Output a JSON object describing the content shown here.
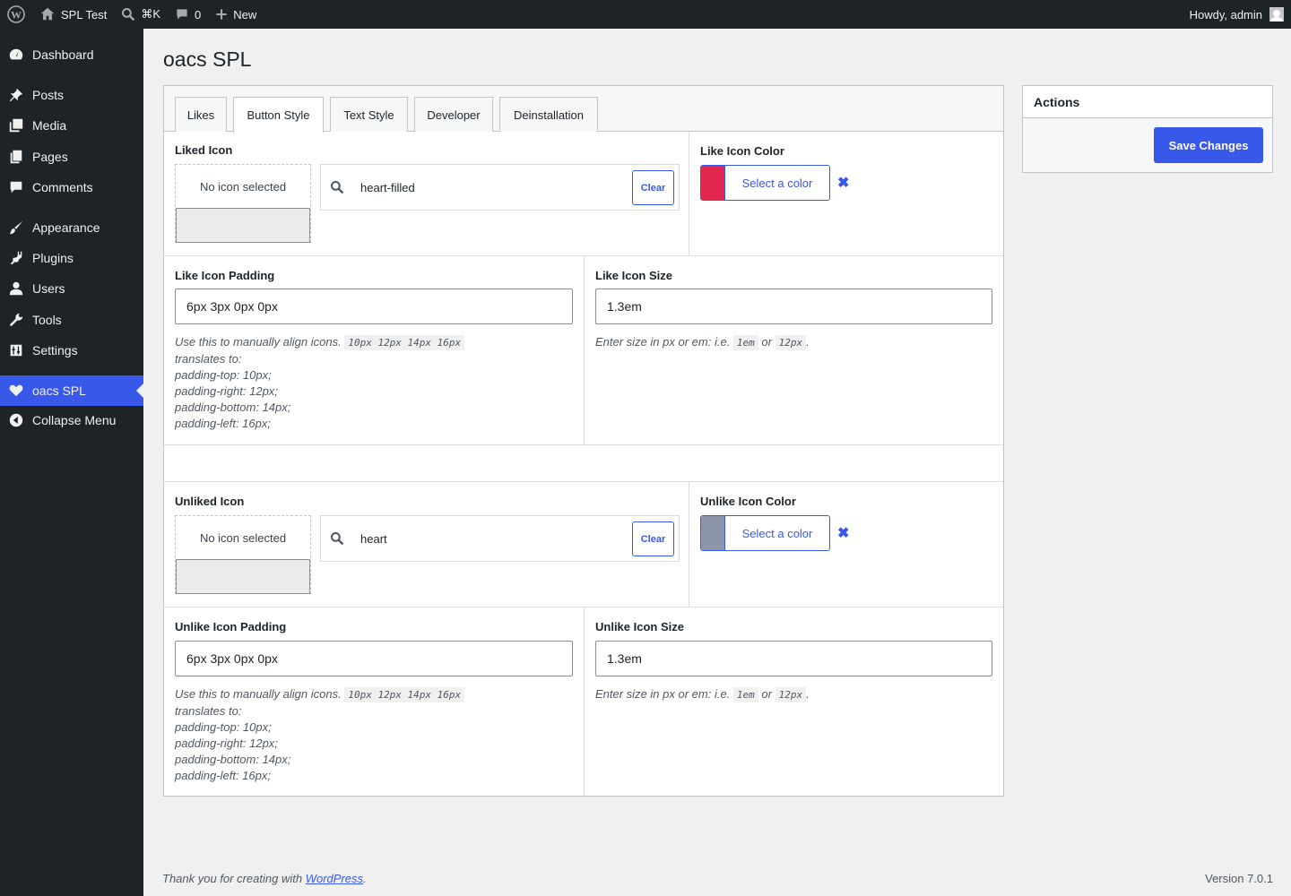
{
  "adminbar": {
    "site_name": "SPL Test",
    "search_shortcut": "⌘K",
    "comments_count": "0",
    "new_label": "New",
    "howdy": "Howdy, admin"
  },
  "sidebar": {
    "items": [
      {
        "label": "Dashboard",
        "icon": "dashboard-icon"
      },
      {
        "label": "Posts",
        "icon": "pin-icon"
      },
      {
        "label": "Media",
        "icon": "media-icon"
      },
      {
        "label": "Pages",
        "icon": "pages-icon"
      },
      {
        "label": "Comments",
        "icon": "comment-icon"
      },
      {
        "label": "Appearance",
        "icon": "brush-icon"
      },
      {
        "label": "Plugins",
        "icon": "plug-icon"
      },
      {
        "label": "Users",
        "icon": "user-icon"
      },
      {
        "label": "Tools",
        "icon": "wrench-icon"
      },
      {
        "label": "Settings",
        "icon": "sliders-icon"
      },
      {
        "label": "oacs SPL",
        "icon": "heart-icon"
      },
      {
        "label": "Collapse Menu",
        "icon": "collapse-icon"
      }
    ]
  },
  "page": {
    "title": "oacs SPL"
  },
  "tabs": [
    "Likes",
    "Button Style",
    "Text Style",
    "Developer",
    "Deinstallation"
  ],
  "liked": {
    "icon_label": "Liked Icon",
    "no_icon": "No icon selected",
    "search_value": "heart-filled",
    "clear_label": "Clear",
    "color_label": "Like Icon Color",
    "color_button": "Select a color",
    "color_value": "#e2264d",
    "padding_label": "Like Icon Padding",
    "padding_value": "6px 3px 0px 0px",
    "size_label": "Like Icon Size",
    "size_value": "1.3em"
  },
  "unliked": {
    "icon_label": "Unliked Icon",
    "no_icon": "No icon selected",
    "search_value": "heart",
    "clear_label": "Clear",
    "color_label": "Unlike Icon Color",
    "color_button": "Select a color",
    "color_value": "#8c96a8",
    "padding_label": "Unlike Icon Padding",
    "padding_value": "6px 3px 0px 0px",
    "size_label": "Unlike Icon Size",
    "size_value": "1.3em"
  },
  "help": {
    "padding_intro": "Use this to manually align icons.",
    "padding_code": "10px 12px 14px 16px",
    "translates": "translates to:",
    "lines": [
      "padding-top: 10px;",
      "padding-right: 12px;",
      "padding-bottom: 14px;",
      "padding-left: 16px;"
    ],
    "size_intro": "Enter size in px or em: i.e.",
    "size_code1": "1em",
    "size_or": "or",
    "size_code2": "12px",
    "size_end": "."
  },
  "actions": {
    "title": "Actions",
    "save": "Save Changes"
  },
  "footer": {
    "thanks": "Thank you for creating with",
    "link": "WordPress",
    "period": ".",
    "version": "Version 7.0.1"
  }
}
